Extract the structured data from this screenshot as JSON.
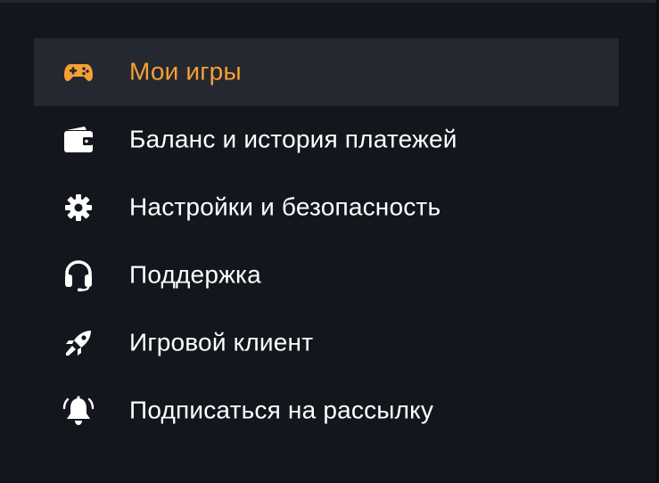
{
  "colors": {
    "background": "#14161d",
    "active_background": "#252831",
    "accent": "#f5a032",
    "text": "#ffffff"
  },
  "menu": {
    "items": [
      {
        "label": "Мои игры",
        "icon": "gamepad-icon",
        "active": true
      },
      {
        "label": "Баланс и история платежей",
        "icon": "wallet-icon",
        "active": false
      },
      {
        "label": "Настройки и безопасность",
        "icon": "gear-icon",
        "active": false
      },
      {
        "label": "Поддержка",
        "icon": "headset-icon",
        "active": false
      },
      {
        "label": "Игровой клиент",
        "icon": "rocket-icon",
        "active": false
      },
      {
        "label": "Подписаться на рассылку",
        "icon": "bell-icon",
        "active": false
      }
    ]
  }
}
